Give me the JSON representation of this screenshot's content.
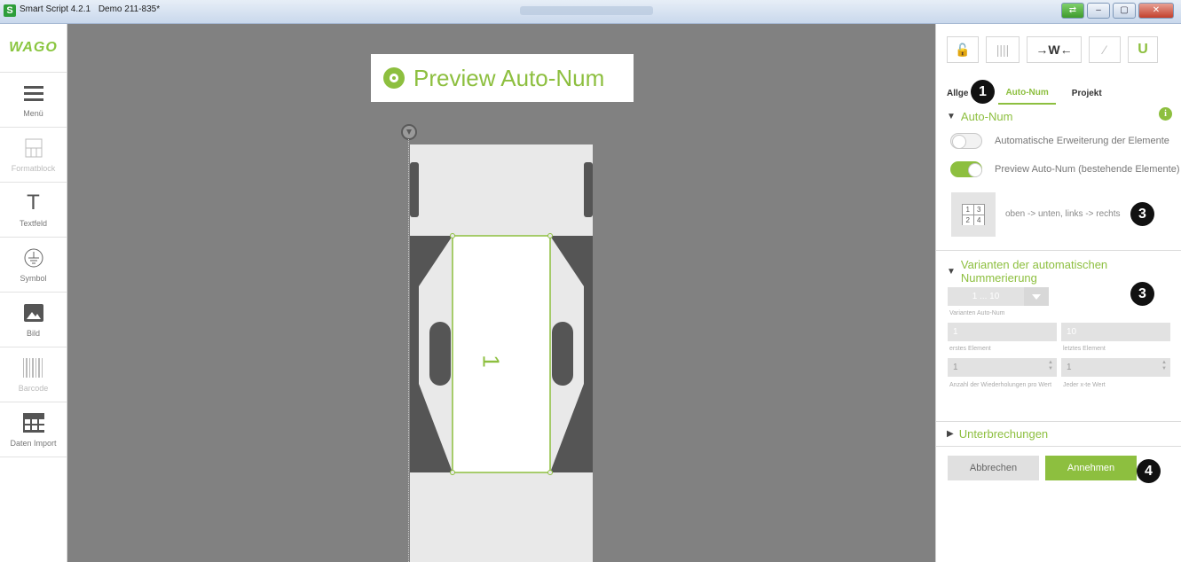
{
  "titlebar": {
    "app": "Smart Script 4.2.1",
    "document": "Demo 211-835*"
  },
  "left_toolbar": {
    "logo": "WAGO",
    "tools": [
      {
        "label": "Menü",
        "icon": "menu-icon",
        "enabled": true
      },
      {
        "label": "Formatblock",
        "icon": "formatblock-icon",
        "enabled": false
      },
      {
        "label": "Textfeld",
        "icon": "textfield-icon",
        "enabled": true
      },
      {
        "label": "Symbol",
        "icon": "ground-symbol-icon",
        "enabled": true
      },
      {
        "label": "Bild",
        "icon": "image-icon",
        "enabled": true
      },
      {
        "label": "Barcode",
        "icon": "barcode-icon",
        "enabled": false
      },
      {
        "label": "Daten Import",
        "icon": "table-import-icon",
        "enabled": true
      }
    ]
  },
  "canvas": {
    "preview_label": "Preview Auto-Num",
    "strip_number": "1",
    "colors": {
      "background": "#818181",
      "accent": "#8dbf3f"
    }
  },
  "right_panel": {
    "top_icons": [
      "lock-icon",
      "columns-icon",
      "fit-width-icon",
      "magic-wand-icon",
      "magnet-icon"
    ],
    "fit_width_label": "→W←",
    "tabs": [
      "Allge",
      "Auto-Num",
      "Projekt"
    ],
    "active_tab": "Auto-Num",
    "badges": {
      "one": "1",
      "three": "3",
      "four": "4"
    },
    "auto_num": {
      "title": "Auto-Num",
      "toggle1_label": "Automatische Erweiterung der Elemente",
      "toggle1_on": false,
      "toggle2_label": "Preview Auto-Num (bestehende Elemente)",
      "toggle2_on": true,
      "order_cells": [
        "1",
        "3",
        "2",
        "4"
      ],
      "order_text": "oben -> unten, links -> rechts"
    },
    "variants": {
      "title": "Varianten der automatischen Nummerierung",
      "select_value": "1 ... 10",
      "select_label": "Varianten Auto-Num",
      "first_value": "1",
      "first_label": "erstes Element",
      "last_value": "10",
      "last_label": "letztes Element",
      "repeat_value": "1",
      "repeat_label": "Anzahl der Wiederholungen pro Wert",
      "every_value": "1",
      "every_label": "Jeder x-te Wert"
    },
    "interruptions": {
      "title": "Unterbrechungen"
    },
    "buttons": {
      "cancel": "Abbrechen",
      "accept": "Annehmen"
    }
  }
}
